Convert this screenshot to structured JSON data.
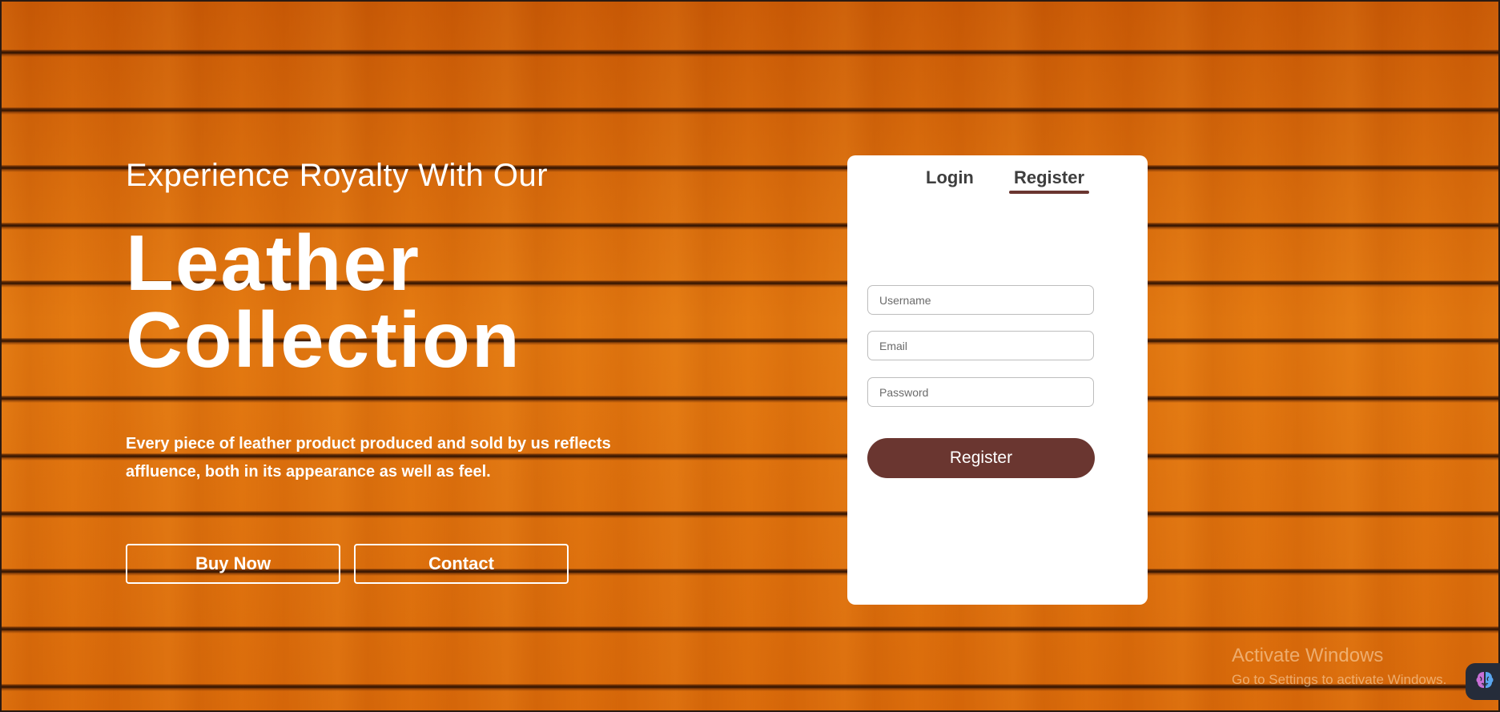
{
  "hero": {
    "kicker": "Experience Royalty With Our",
    "title_line1": "Leather",
    "title_line2": "Collection",
    "description": "Every piece of leather product produced and sold by us reflects affluence, both in its appearance as well as feel.",
    "buy_label": "Buy Now",
    "contact_label": "Contact"
  },
  "auth": {
    "tabs": [
      {
        "label": "Login",
        "active": false
      },
      {
        "label": "Register",
        "active": true
      }
    ],
    "username_placeholder": "Username",
    "email_placeholder": "Email",
    "password_placeholder": "Password",
    "submit_label": "Register"
  },
  "windows": {
    "activate_title": "Activate Windows",
    "activate_sub": "Go to Settings to activate Windows."
  },
  "colors": {
    "accent": "#6a3630",
    "wood": "#d9680a",
    "card": "#ffffff"
  },
  "icons": {
    "assistant": "brain-icon"
  }
}
